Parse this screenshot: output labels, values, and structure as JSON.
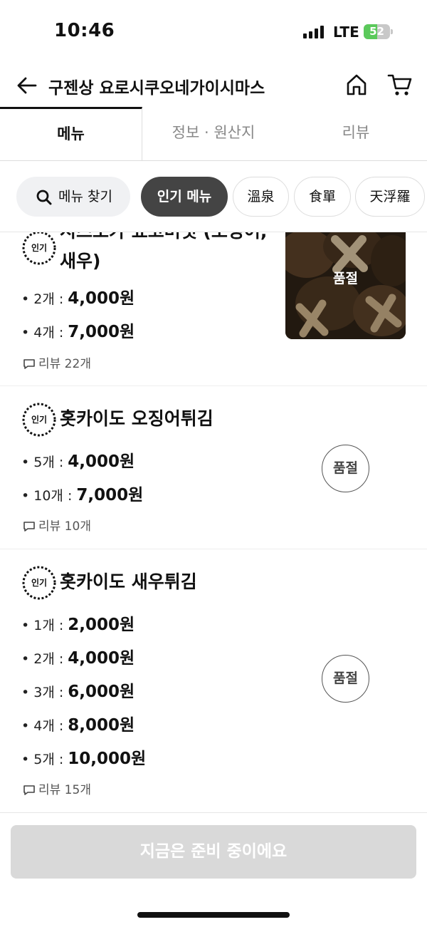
{
  "status_bar": {
    "time": "10:46",
    "network": "LTE",
    "battery": "52",
    "battery_level": 0.52
  },
  "header": {
    "title": "구젠상 요로시쿠오네가이시마스"
  },
  "tabs": [
    {
      "label": "메뉴",
      "active": true
    },
    {
      "label": "정보 · 원산지",
      "active": false
    },
    {
      "label": "리뷰",
      "active": false
    }
  ],
  "filters": {
    "search_label": "메뉴 찾기",
    "chips": [
      "인기 메뉴",
      "溫泉",
      "食單",
      "天浮羅"
    ]
  },
  "menu_items": [
    {
      "badge": "인기",
      "name_line1": "시즈오카 표고버섯 (오징어,",
      "name_line2": "새우)",
      "prices": [
        {
          "qty": "• 2개 : ",
          "price": "4,000원"
        },
        {
          "qty": "• 4개 : ",
          "price": "7,000원"
        }
      ],
      "review": "리뷰 22개",
      "status": "품절"
    },
    {
      "badge": "인기",
      "name_line1": "홋카이도 오징어튀김",
      "prices": [
        {
          "qty": "• 5개 : ",
          "price": "4,000원"
        },
        {
          "qty": "• 10개 : ",
          "price": "7,000원"
        }
      ],
      "review": "리뷰 10개",
      "status": "품절"
    },
    {
      "badge": "인기",
      "name_line1": "홋카이도 새우튀김",
      "prices": [
        {
          "qty": "• 1개 : ",
          "price": "2,000원"
        },
        {
          "qty": "• 2개 : ",
          "price": "4,000원"
        },
        {
          "qty": "• 3개 : ",
          "price": "6,000원"
        },
        {
          "qty": "• 4개 : ",
          "price": "8,000원"
        },
        {
          "qty": "• 5개 : ",
          "price": "10,000원"
        }
      ],
      "review": "리뷰 15개",
      "status": "품절"
    }
  ],
  "cta": {
    "label": "지금은 준비 중이에요"
  },
  "colors": {
    "active_chip": "#444444",
    "cta_disabled": "#d9d9d9",
    "battery_green": "#5bc95b"
  }
}
